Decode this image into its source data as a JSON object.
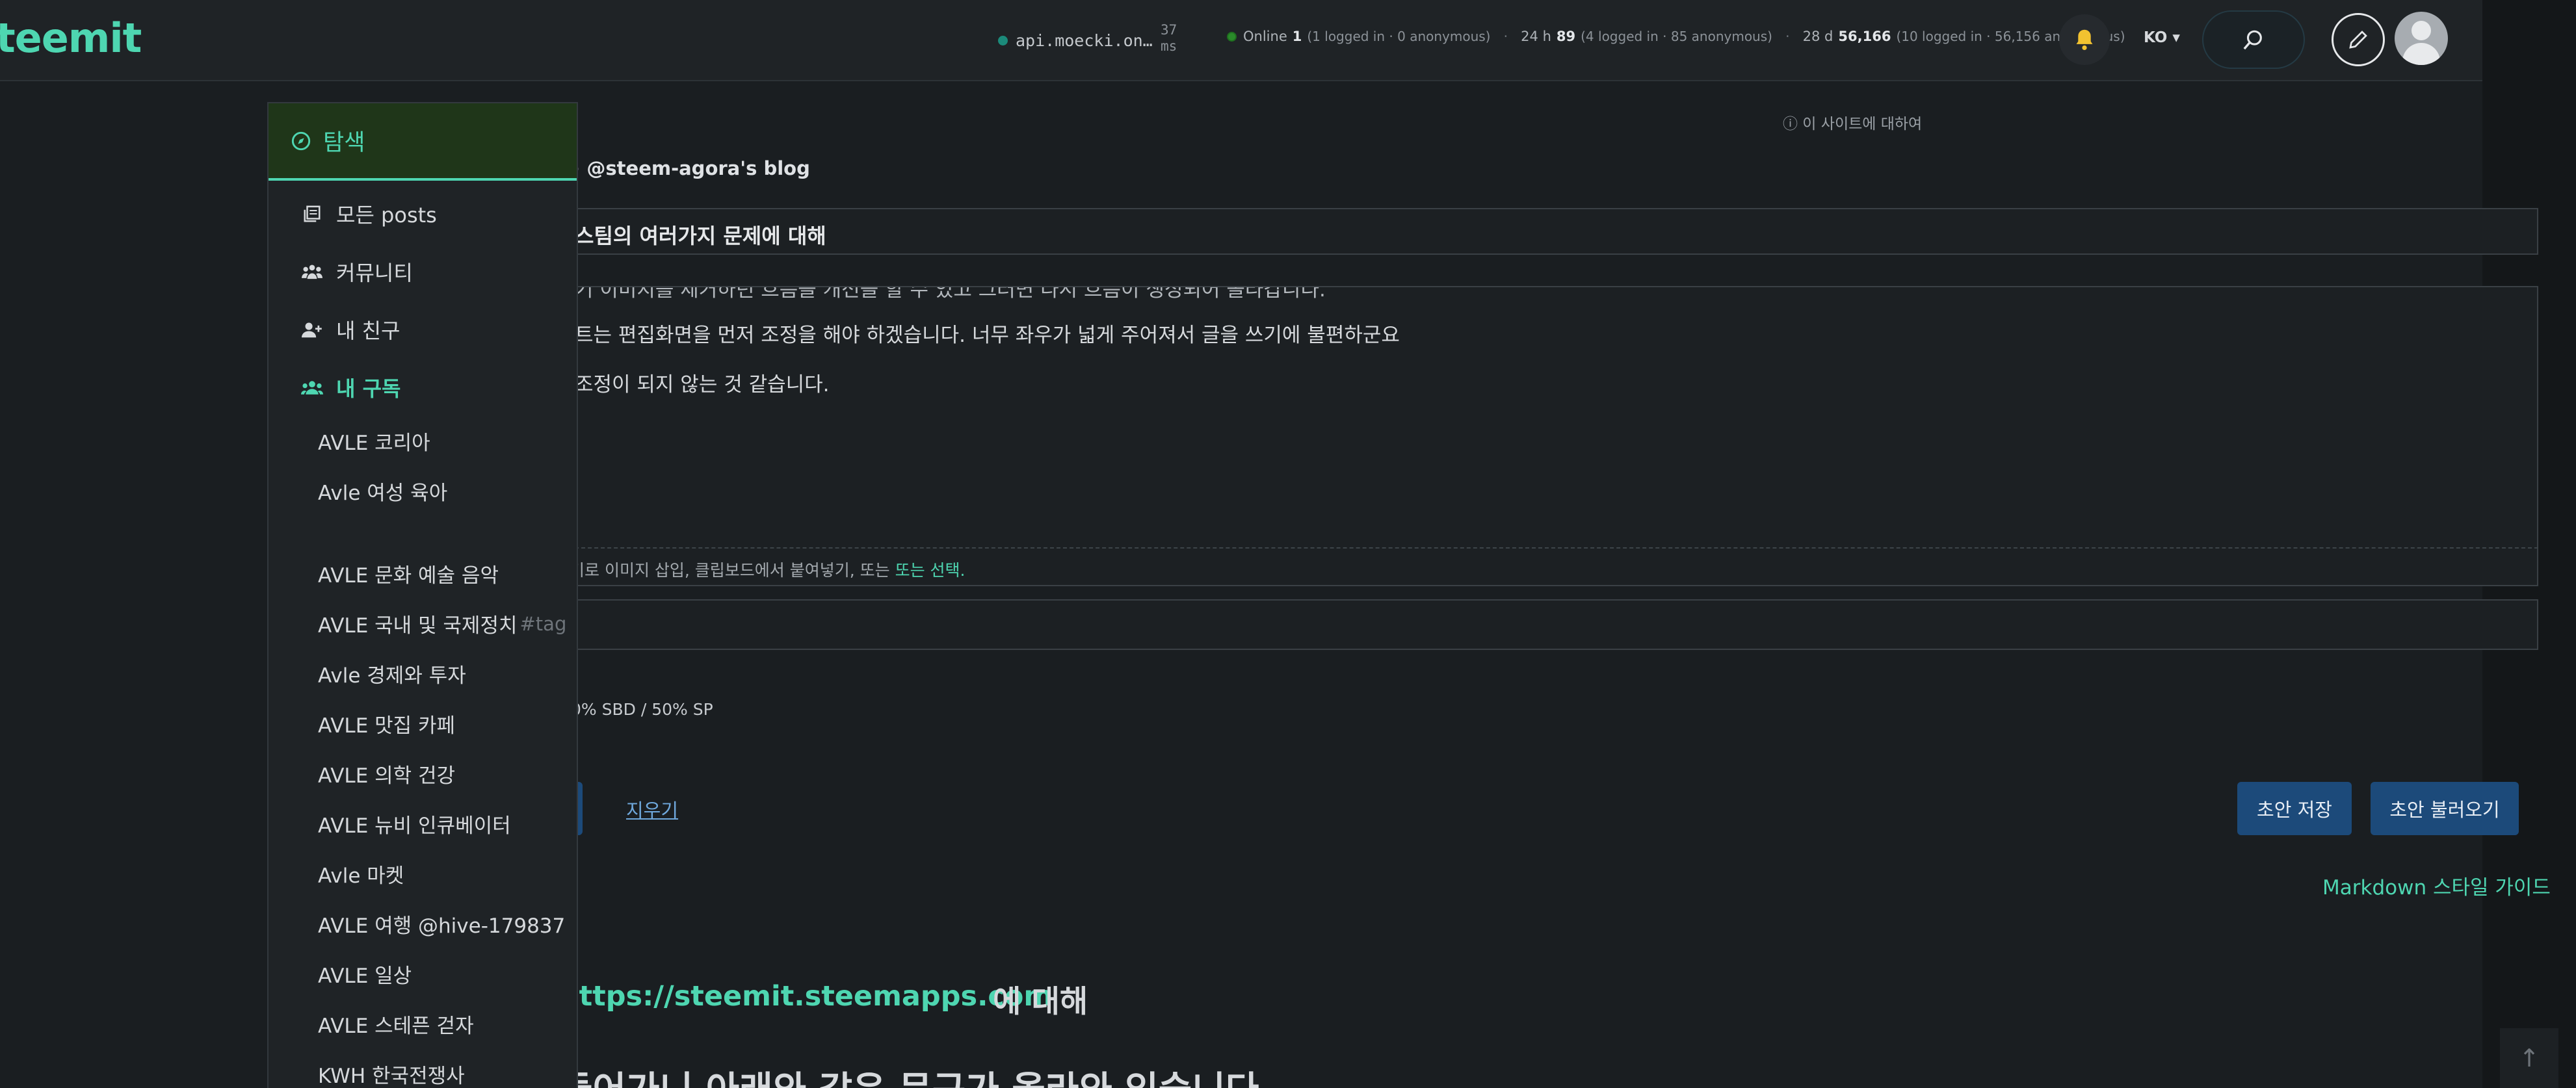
{
  "header": {
    "logo": "teemit",
    "api_host": "api.moecki.on…",
    "latency_value": "37",
    "latency_unit": "ms",
    "online_label": "Online",
    "online_count": "1",
    "online_detail": "(1 logged in · 0 anonymous)",
    "day_label": "24 h",
    "day_count": "89",
    "day_detail": "(4 logged in · 85 anonymous)",
    "month_label": "28 d",
    "month_count": "56,166",
    "month_detail": "(10 logged in · 56,156 anonymous)",
    "language": "KO ▾",
    "colors": {
      "accent": "#4ed6b1",
      "button": "#1c4a7a"
    }
  },
  "sidebar": {
    "explore": "탐색",
    "items": [
      {
        "label": "모든 posts",
        "icon": "posts-icon"
      },
      {
        "label": "커뮤니티",
        "icon": "community-icon"
      },
      {
        "label": "내 친구",
        "icon": "friends-icon"
      },
      {
        "label": "내 구독",
        "icon": "subscriptions-icon"
      }
    ],
    "subscriptions": [
      "AVLE 코리아",
      "Avle 여성 육아",
      "AVLE 문화 예술 음악",
      "AVLE 국내 및 국제정치",
      "Avle 경제와 투자",
      "AVLE 맛집 카페",
      "AVLE 의학 건강",
      "AVLE 뉴비 인큐베이터",
      "Avle 마켓",
      "AVLE 여행 @hive-179837",
      "AVLE 일상",
      "AVLE 스테픈 걷자",
      "KWH 한국전쟁사"
    ],
    "tag_placeholder": "#tag"
  },
  "editor": {
    "about_site": "ⓘ 이 사이트에 대하여",
    "blog_link": "⊳ @steem-agora's blog",
    "title": "스팀의 여러가지 문제에 대해",
    "body_lines": [
      "기 이미지를 제거하던 흐름을 개선을 할 수 있고 그러면 다시 흐름이 생성되어 올라갑니다.",
      "트는 편집화면을 먼저 조정을 해야 하겠습니다. 너무 좌우가 넓게 주어져서 글을 쓰기에 불편하군요",
      "조정이 되지 않는 것 같습니다."
    ],
    "dropzone_text": "기로 이미지 삽입, 클립보드에서 붙여넣기, 또는",
    "dropzone_select": "또는 선택.",
    "payout": "0% SBD / 50% SP",
    "clear": "지우기",
    "save_draft": "초안 저장",
    "load_draft": "초안 불러오기",
    "markdown_guide": "Markdown 스타일 가이드"
  },
  "preview": {
    "url": "https://steemit.steemapps.com",
    "about": "에 대해",
    "heading": "들어가니 아래와 같은 문구가 올라와 있습니다"
  },
  "scroll_top": "↑"
}
